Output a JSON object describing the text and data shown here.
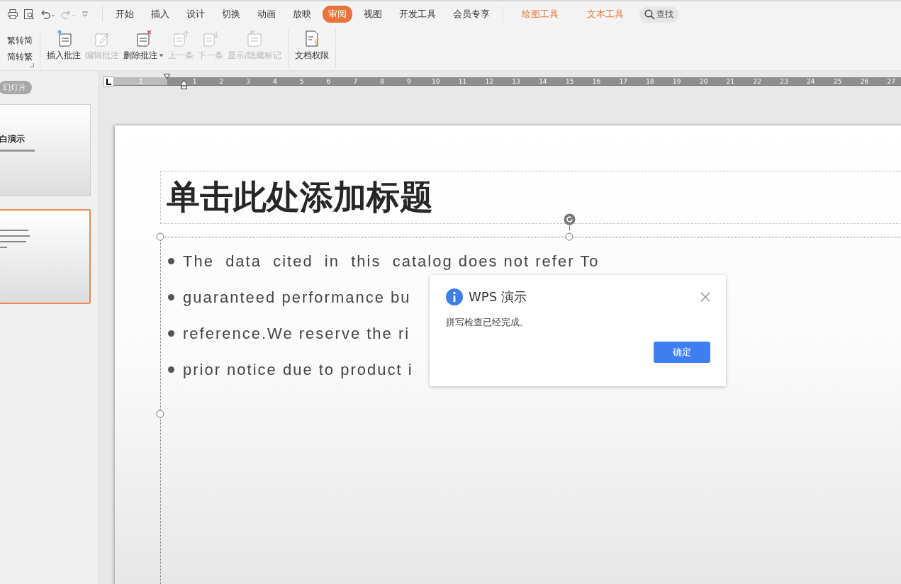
{
  "menu_tabs": [
    {
      "label": "开始",
      "selected": false
    },
    {
      "label": "插入",
      "selected": false
    },
    {
      "label": "设计",
      "selected": false
    },
    {
      "label": "切换",
      "selected": false
    },
    {
      "label": "动画",
      "selected": false
    },
    {
      "label": "放映",
      "selected": false
    },
    {
      "label": "审阅",
      "selected": true
    },
    {
      "label": "视图",
      "selected": false
    },
    {
      "label": "开发工具",
      "selected": false
    },
    {
      "label": "会员专享",
      "selected": false
    }
  ],
  "context_tabs": [
    {
      "label": "绘图工具"
    },
    {
      "label": "文本工具"
    }
  ],
  "search": {
    "label": "查找"
  },
  "ribbon": {
    "convert": [
      {
        "label": "繁转简"
      },
      {
        "label": "简转繁"
      }
    ],
    "groups": [
      [
        {
          "label": "插入批注",
          "kind": "insert",
          "disabled": false,
          "dropdown": false
        },
        {
          "label": "编辑批注",
          "kind": "edit",
          "disabled": true,
          "dropdown": false
        },
        {
          "label": "删除批注",
          "kind": "delete",
          "disabled": false,
          "dropdown": true
        },
        {
          "label": "上一条",
          "kind": "previous",
          "disabled": true,
          "dropdown": false
        },
        {
          "label": "下一条",
          "kind": "next",
          "disabled": true,
          "dropdown": false
        },
        {
          "label": "显示/隐藏标记",
          "kind": "markup",
          "disabled": true,
          "dropdown": false
        }
      ],
      [
        {
          "label": "文档权限",
          "kind": "permission",
          "disabled": false,
          "dropdown": false
        }
      ]
    ]
  },
  "slides_panel": {
    "label": "幻灯片",
    "thumbnails": [
      {
        "title": "白演示",
        "selected": false
      },
      {
        "selected": true
      }
    ]
  },
  "ruler": {
    "left_labels": [
      "1"
    ],
    "right_labels": [
      "1",
      "2",
      "3",
      "4",
      "5",
      "6",
      "7",
      "8",
      "9",
      "10",
      "11",
      "12",
      "13",
      "14",
      "15",
      "16",
      "17",
      "18",
      "19",
      "20",
      "21",
      "22",
      "23",
      "24",
      "25",
      "26",
      "27"
    ]
  },
  "slide": {
    "title": "单击此处添加标题",
    "bullets": [
      "The  data  cited  in  this  catalog does not refer To",
      "guaranteed performance bu",
      "reference.We reserve the ri",
      "prior notice due to product i"
    ]
  },
  "dialog": {
    "title": "WPS 演示",
    "message": "拼写检查已经完成。",
    "button": "确定"
  }
}
